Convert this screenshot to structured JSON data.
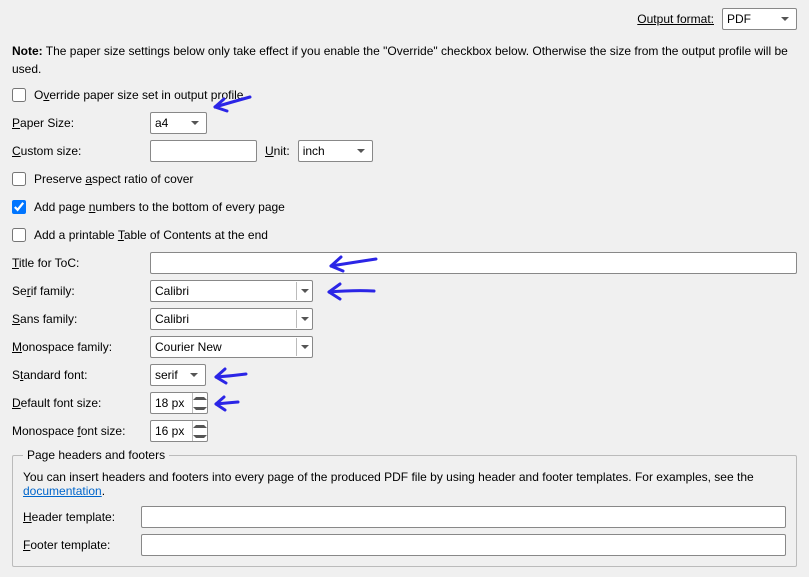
{
  "outputFormat": {
    "label": "Output format:",
    "value": "PDF"
  },
  "noteBold": "Note:",
  "noteText": "The paper size settings below only take effect if you enable the \"Override\" checkbox below. Otherwise the size from the output profile will be used.",
  "override": {
    "label_pre": "O",
    "label_u": "v",
    "label_post": "erride paper size set in output profile",
    "checked": false
  },
  "paperSize": {
    "label_u": "P",
    "label_post": "aper Size:",
    "value": "a4"
  },
  "customSize": {
    "label_u": "C",
    "label_post": "ustom size:",
    "value": ""
  },
  "unit": {
    "label_u": "U",
    "label_post": "nit:",
    "value": "inch"
  },
  "preserveAspect": {
    "label_pre": "Preserve ",
    "label_u": "a",
    "label_post": "spect ratio of cover",
    "checked": false
  },
  "pageNumbers": {
    "label_pre": "Add page ",
    "label_u": "n",
    "label_post": "umbers to the bottom of every page",
    "checked": true
  },
  "printableToc": {
    "label_pre": "Add a printable ",
    "label_u": "T",
    "label_post": "able of Contents at the end",
    "checked": false
  },
  "titleToc": {
    "label_u": "T",
    "label_post": "itle for ToC:",
    "value": ""
  },
  "serifFamily": {
    "label_pre": "Se",
    "label_u": "r",
    "label_post": "if family:",
    "value": "Calibri"
  },
  "sansFamily": {
    "label_u": "S",
    "label_post": "ans family:",
    "value": "Calibri"
  },
  "monoFamily": {
    "label_u": "M",
    "label_post": "onospace family:",
    "value": "Courier New"
  },
  "stdFont": {
    "label_pre": "S",
    "label_u": "t",
    "label_post": "andard font:",
    "value": "serif"
  },
  "defaultFontSize": {
    "label_pre": "",
    "label_u": "D",
    "label_post": "efault font size:",
    "value": "18 px"
  },
  "monoFontSize": {
    "label_pre": "Monospace ",
    "label_u": "f",
    "label_post": "ont size:",
    "value": "16 px"
  },
  "headersFooters": {
    "legend": "Page headers and footers",
    "desc_pre": "You can insert headers and footers into every page of the produced PDF file by using header and footer templates. For examples, see the ",
    "desc_link": "documentation",
    "desc_post": ".",
    "header": {
      "label_u": "H",
      "label_post": "eader template:",
      "value": ""
    },
    "footer": {
      "label_u": "F",
      "label_post": "ooter template:",
      "value": ""
    }
  },
  "annotationColor": "#2b25e6"
}
